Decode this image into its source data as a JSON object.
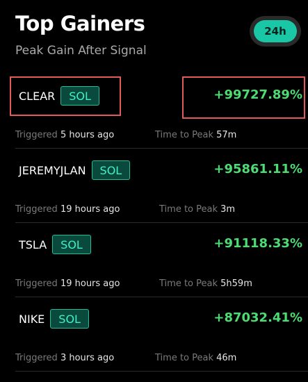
{
  "header": {
    "title": "Top Gainers",
    "subtitle": "Peak Gain After Signal",
    "period": "24h"
  },
  "rows": [
    {
      "symbol": "CLEAR",
      "chain": "SOL",
      "gain": "+99727.89%",
      "triggered_label": "Triggered",
      "triggered_value": "5 hours ago",
      "peak_label": "Time to Peak",
      "peak_value": "57m"
    },
    {
      "symbol": "JEREMYJLAN",
      "chain": "SOL",
      "gain": "+95861.11%",
      "triggered_label": "Triggered",
      "triggered_value": "19 hours ago",
      "peak_label": "Time to Peak",
      "peak_value": "3m"
    },
    {
      "symbol": "TSLA",
      "chain": "SOL",
      "gain": "+91118.33%",
      "triggered_label": "Triggered",
      "triggered_value": "19 hours ago",
      "peak_label": "Time to Peak",
      "peak_value": "5h59m"
    },
    {
      "symbol": "NIKE",
      "chain": "SOL",
      "gain": "+87032.41%",
      "triggered_label": "Triggered",
      "triggered_value": "3 hours ago",
      "peak_label": "Time to Peak",
      "peak_value": "46m"
    }
  ],
  "colors": {
    "accent": "#19c7a6",
    "gain": "#4ddc74",
    "highlight": "#e35a5a"
  }
}
